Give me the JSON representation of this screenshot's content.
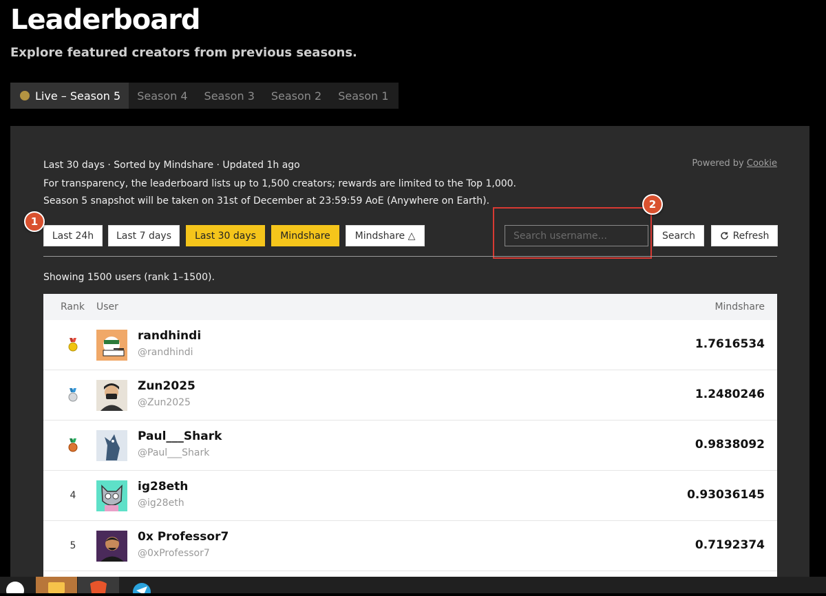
{
  "page": {
    "title": "Leaderboard",
    "subtitle": "Explore featured creators from previous seasons."
  },
  "season_tabs": [
    {
      "label": "Live – Season 5",
      "active": true
    },
    {
      "label": "Season 4",
      "active": false
    },
    {
      "label": "Season 3",
      "active": false
    },
    {
      "label": "Season 2",
      "active": false
    },
    {
      "label": "Season 1",
      "active": false
    }
  ],
  "info": {
    "line1": "Last 30 days · Sorted by Mindshare · Updated 1h ago",
    "line2": "For transparency, the leaderboard lists up to 1,500 creators; rewards are limited to the Top 1,000.",
    "line3": "Season 5 snapshot will be taken on 31st of December at 23:59:59 AoE (Anywhere on Earth).",
    "powered_prefix": "Powered by",
    "powered_link": "Cookie"
  },
  "filters": {
    "last_24h": "Last 24h",
    "last_7d": "Last 7 days",
    "last_30d": "Last 30 days",
    "mindshare": "Mindshare",
    "mindshare_sort": "Mindshare △"
  },
  "search": {
    "placeholder": "Search username...",
    "value": "",
    "button": "Search",
    "refresh": "Refresh"
  },
  "annotations": {
    "badge1": "1",
    "badge2": "2"
  },
  "showing": "Showing 1500 users (rank 1–1500).",
  "table": {
    "headers": {
      "rank": "Rank",
      "user": "User",
      "mindshare": "Mindshare"
    },
    "rows": [
      {
        "rank": "",
        "medal": "gold-medal-icon",
        "name": "randhindi",
        "handle": "@randhindi",
        "score": "1.7616534"
      },
      {
        "rank": "",
        "medal": "silver-medal-icon",
        "name": "Zun2025",
        "handle": "@Zun2025",
        "score": "1.2480246"
      },
      {
        "rank": "",
        "medal": "bronze-medal-icon",
        "name": "Paul___Shark",
        "handle": "@Paul___Shark",
        "score": "0.9838092"
      },
      {
        "rank": "4",
        "medal": "",
        "name": "ig28eth",
        "handle": "@ig28eth",
        "score": "0.93036145"
      },
      {
        "rank": "5",
        "medal": "",
        "name": "0x Professor7",
        "handle": "@0xProfessor7",
        "score": "0.7192374"
      }
    ]
  },
  "colors": {
    "accent_yellow": "#f5c51b",
    "annotation_red": "#d93a33",
    "live_dot": "#b39442"
  }
}
